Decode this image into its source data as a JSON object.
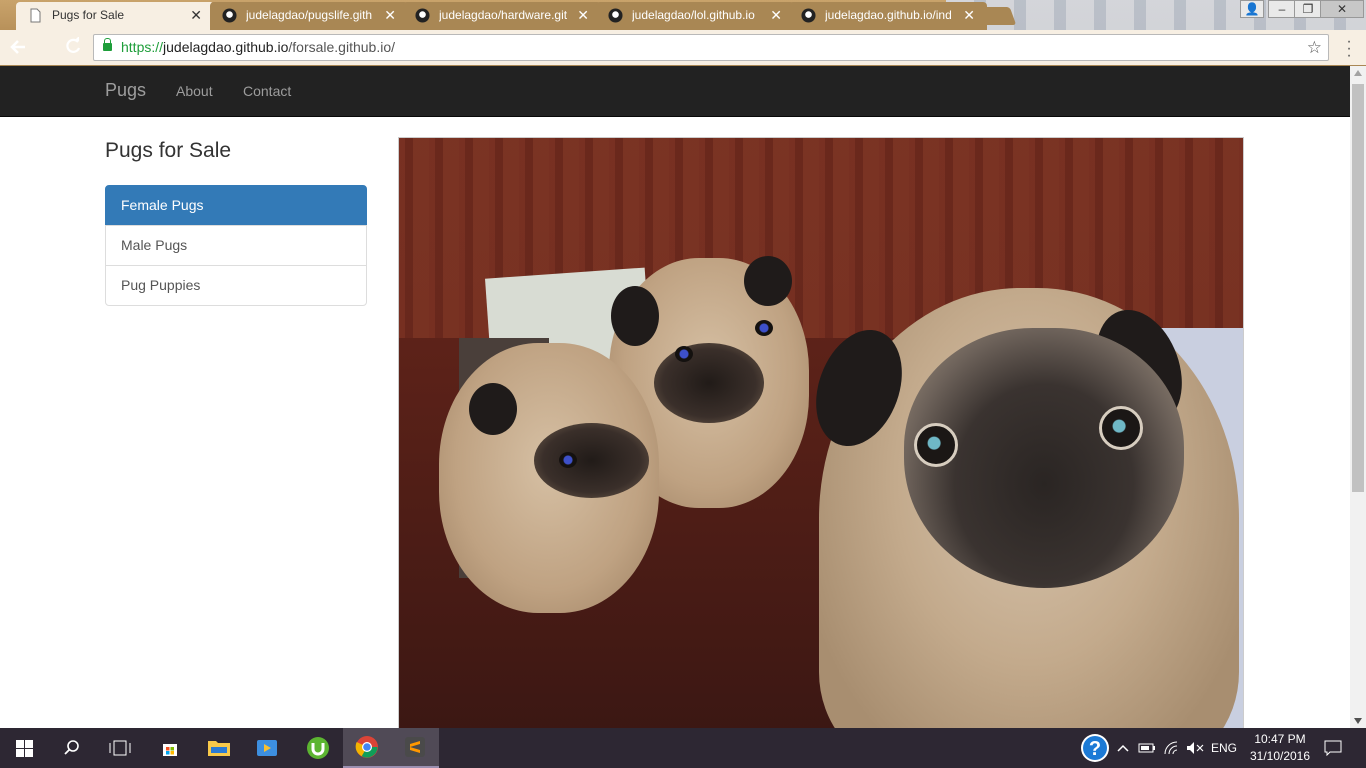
{
  "browser": {
    "tabs": [
      {
        "title": "Pugs for Sale",
        "icon": "page-icon",
        "active": true
      },
      {
        "title": "judelagdao/pugslife.gith",
        "icon": "github-icon",
        "active": false
      },
      {
        "title": "judelagdao/hardware.git",
        "icon": "github-icon",
        "active": false
      },
      {
        "title": "judelagdao/lol.github.io",
        "icon": "github-icon",
        "active": false
      },
      {
        "title": "judelagdao.github.io/ind",
        "icon": "github-icon",
        "active": false
      }
    ],
    "url": {
      "scheme": "https://",
      "host": "judelagdao.github.io",
      "path": "/forsale.github.io/"
    }
  },
  "site": {
    "brand": "Pugs",
    "nav": [
      "About",
      "Contact"
    ],
    "heading": "Pugs for Sale",
    "categories": [
      {
        "label": "Female Pugs",
        "active": true
      },
      {
        "label": "Male Pugs",
        "active": false
      },
      {
        "label": "Pug Puppies",
        "active": false
      }
    ],
    "accent_color": "#337ab7",
    "navbar_color": "#222222"
  },
  "taskbar": {
    "apps": [
      "start-icon",
      "search-icon",
      "task-view-icon",
      "store-icon",
      "file-explorer-icon",
      "media-player-icon",
      "utorrent-icon",
      "chrome-icon",
      "sublime-text-icon"
    ],
    "language": "ENG",
    "time": "10:47 PM",
    "date": "31/10/2016"
  }
}
